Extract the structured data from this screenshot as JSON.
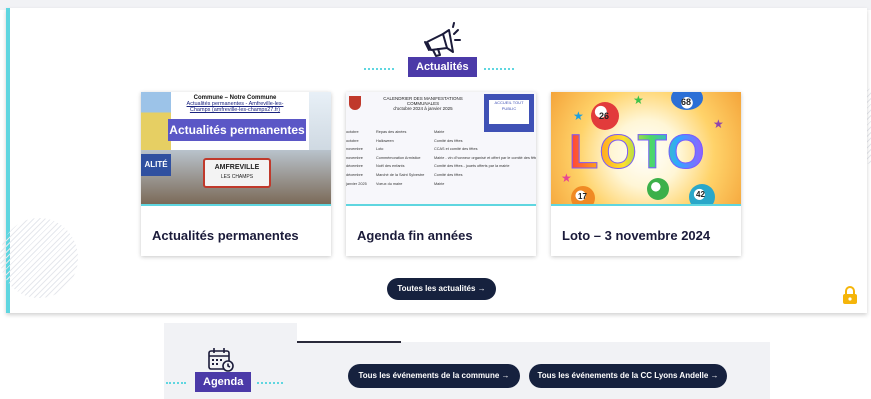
{
  "news": {
    "section_label": "Actualités",
    "cards": [
      {
        "title": "Actualités permanentes",
        "thumb": {
          "line1": "Commune – Notre Commune",
          "line2": "Actualités permanentes - Amfreville-les-",
          "line3": "Champs (amfreville-les-champs27.fr)",
          "band": "Actualités permanentes",
          "alite": "ALITÉ",
          "sign1": "AMFREVILLE",
          "sign2": "LES CHAMPS"
        }
      },
      {
        "title": "Agenda fin années",
        "thumb": {
          "head1": "CALENDRIER DES MANIFESTATIONS COMMUNALES",
          "head2": "d'octobre 2024 à janvier 2025",
          "img_label": "ACCUEIL TOUT PUBLIC",
          "rows": [
            [
              "octobre",
              "Repas des ainées",
              "Mairie"
            ],
            [
              "octobre",
              "Halloween",
              "Comité des fêtes"
            ],
            [
              "novembre",
              "Loto",
              "CCAS et comité des fêtes"
            ],
            [
              "novembre",
              "Commémoration Armistice",
              "Mairie - vin d'honneur organisé et offert par le comité des fêtes"
            ],
            [
              "décembre",
              "Noël des enfants",
              "Comité des fêtes - jouets offerts par la mairie"
            ],
            [
              "décembre",
              "Marché de la Saint Sylvestre",
              "Comité des fêtes"
            ],
            [
              "janvier 2025",
              "Voeux du maire",
              "Mairie"
            ]
          ]
        }
      },
      {
        "title": "Loto – 3 novembre 2024",
        "thumb": {
          "word": "LOTO",
          "balls": [
            "26",
            "68",
            "42",
            "17"
          ]
        }
      }
    ],
    "all_button": "Toutes les actualités →"
  },
  "agenda": {
    "section_label": "Agenda",
    "button_commune": "Tous les événements de la commune →",
    "button_cc": "Tous les événements de la CC Lyons Andelle →"
  },
  "icons": {
    "news": "megaphone-icon",
    "agenda": "calendar-icon",
    "lock": "lock-icon"
  },
  "colors": {
    "accent": "#5fd6e0",
    "tag": "#4b3aa8",
    "button": "#16213e",
    "lock": "#f5b50a"
  }
}
